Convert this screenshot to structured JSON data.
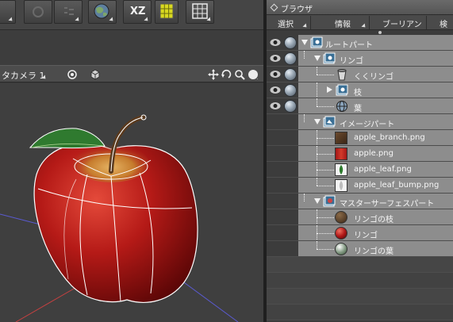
{
  "viewport": {
    "camera_label": "タカメラ 1"
  },
  "toolbar": {
    "xz_label": "XZ"
  },
  "browser": {
    "title": "ブラウザ",
    "tabs": [
      {
        "label": "選択"
      },
      {
        "label": "情報"
      },
      {
        "label": "ブーリアン"
      },
      {
        "label": "検"
      }
    ],
    "tree": [
      {
        "label": "ルートパート"
      },
      {
        "label": "リンゴ"
      },
      {
        "label": "くくリンゴ"
      },
      {
        "label": "枝"
      },
      {
        "label": "葉"
      },
      {
        "label": "イメージパート"
      },
      {
        "label": "apple_branch.png"
      },
      {
        "label": "apple.png"
      },
      {
        "label": "apple_leaf.png"
      },
      {
        "label": "apple_leaf_bump.png"
      },
      {
        "label": "マスターサーフェスパート"
      },
      {
        "label": "リンゴの枝"
      },
      {
        "label": "リンゴ"
      },
      {
        "label": "リンゴの葉"
      }
    ]
  },
  "colors": {
    "panel_bg": "#3c3c3c",
    "row_highlight": "#8d8d8d",
    "apple_red": "#b01818",
    "leaf_green": "#2f7a2f",
    "grid_button_yellow": "#d8d820"
  }
}
